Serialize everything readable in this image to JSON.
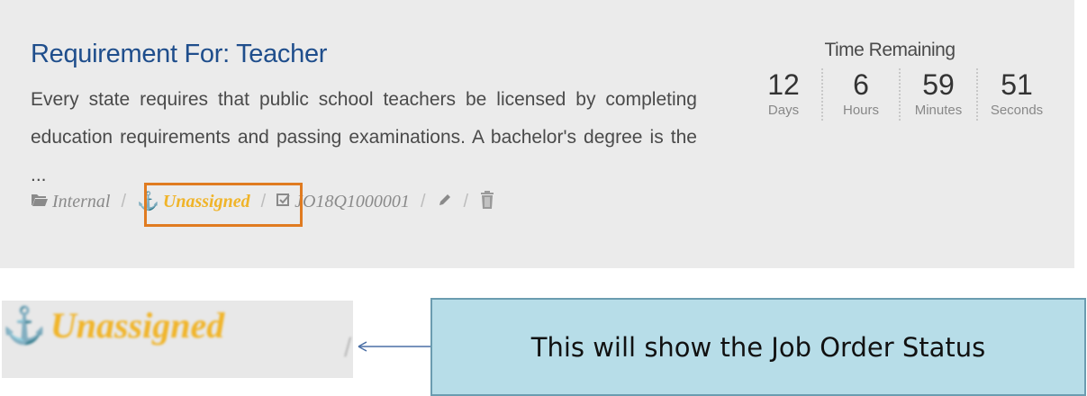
{
  "job": {
    "title": "Requirement For: Teacher",
    "description": "Every state requires that public school teachers be licensed by completing education requirements and passing examinations. A bachelor's degree is the ...",
    "meta": {
      "category": "Internal",
      "status": "Unassigned",
      "job_order_id": "JO18Q1000001",
      "separator": "/"
    }
  },
  "timer": {
    "title": "Time Remaining",
    "units": [
      {
        "value": "12",
        "label": "Days"
      },
      {
        "value": "6",
        "label": "Hours"
      },
      {
        "value": "59",
        "label": "Minutes"
      },
      {
        "value": "51",
        "label": "Seconds"
      }
    ]
  },
  "zoom": {
    "status": "Unassigned"
  },
  "callout": {
    "text": "This will show the Job Order Status"
  },
  "colors": {
    "status": "#f0b429",
    "highlight_border": "#e07b20",
    "title": "#1f4e8c",
    "callout_bg": "#b7dde8"
  },
  "icons": {
    "category": "folder-open-icon",
    "status": "anchor-icon",
    "job_order": "check-square-icon",
    "edit": "pencil-icon",
    "delete": "trash-icon"
  }
}
